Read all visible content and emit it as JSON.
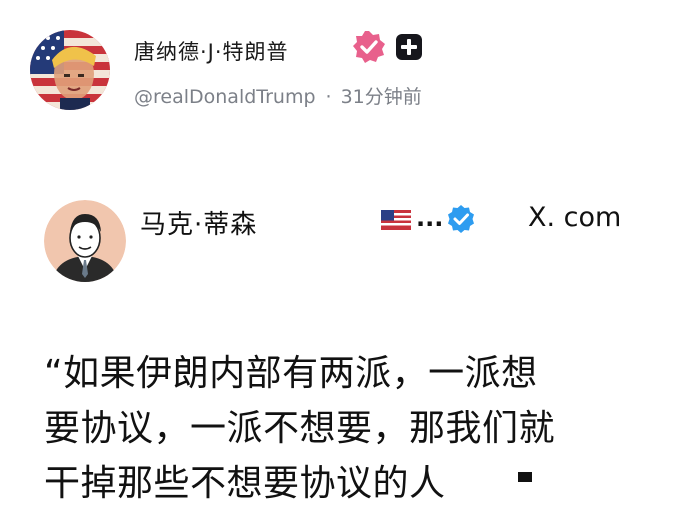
{
  "post": {
    "display_name": "唐纳德·J·特朗普",
    "handle": "@realDonaldTrump",
    "separator": "·",
    "time_ago": "31分钟前"
  },
  "quoted": {
    "display_name": "马克·蒂森",
    "ellipsis": "...",
    "source": "X. com"
  },
  "quote": {
    "lines": [
      "“如果伊朗内部有两派，一派想",
      "要协议，一派不想要，那我们就",
      "干掉那些不想要协议的人"
    ]
  },
  "colors": {
    "verified_badge": "#e8608c",
    "x_verified_badge": "#2d9cf0",
    "plus_badge": "#16161c",
    "handle_text": "#7c8088"
  },
  "icons": {
    "main_verified": "verified-rosette-icon",
    "plus": "plus-badge-icon",
    "flag": "us-flag-icon",
    "quoted_verified": "blue-verified-icon"
  }
}
